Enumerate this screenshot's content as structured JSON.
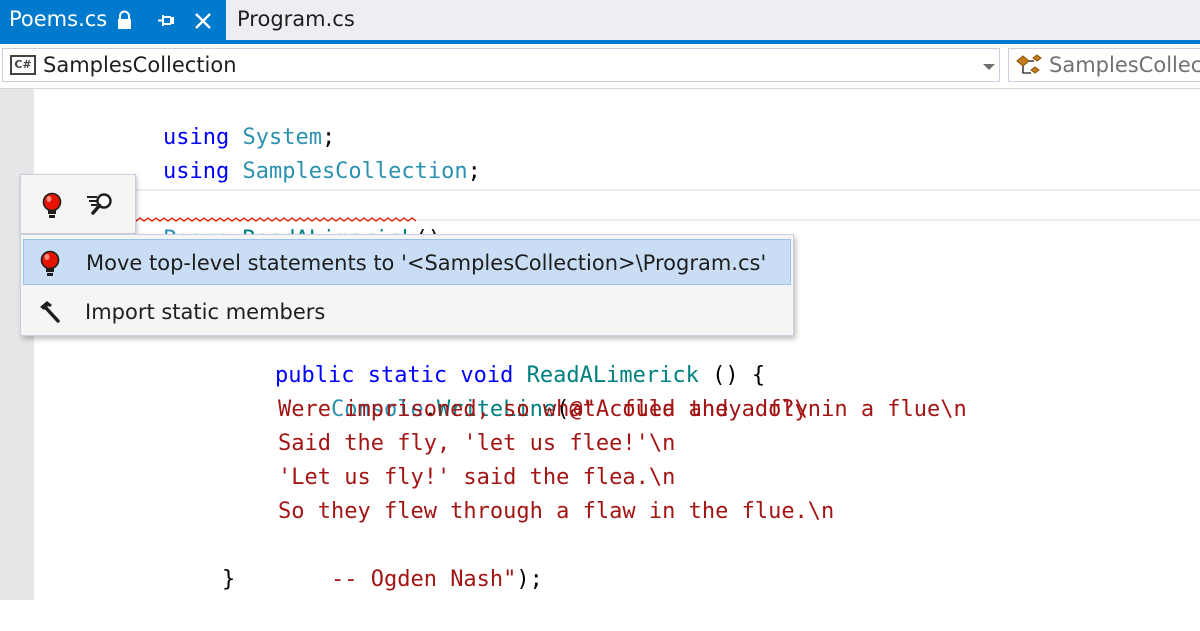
{
  "tabs": [
    {
      "label": "Poems.cs",
      "active": true
    },
    {
      "label": "Program.cs",
      "active": false
    }
  ],
  "navbar": {
    "project_icon": "csharp-file-icon",
    "project_label": "SamplesCollection",
    "member_icon": "class-icon",
    "member_label": "SamplesCollection"
  },
  "editor": {
    "line_using_1": {
      "kw": "using",
      "name": "System",
      "end": ";"
    },
    "line_using_2": {
      "kw": "using",
      "name": "SamplesCollection",
      "end": ";"
    },
    "line_call": {
      "obj": "Poems",
      "dot": ".",
      "method": "ReadALimerick",
      "end": "();"
    },
    "line_method": {
      "mods": "public static void",
      "method": "ReadALimerick",
      "end": "() {"
    },
    "line_writeline": {
      "obj": "Console",
      "dot": ".",
      "method": "WriteLine",
      "open": "(",
      "str": "@\"A flea and a fly in a flue\\n"
    },
    "poem_lines": [
      "Were imprisoned, so what could they do?\\n",
      "Said the fly, 'let us flee!'\\n",
      "'Let us fly!' said the flea.\\n",
      "So they flew through a flaw in the flue.\\n",
      "-- Ogden Nash\""
    ],
    "poem_end": ");",
    "closing_brace": "}"
  },
  "quick_actions": {
    "bulb_icon": "lightbulb-error-icon",
    "preview_icon": "preview-changes-icon",
    "items": [
      {
        "icon": "lightbulb-error-icon",
        "label": "Move top-level statements to '<SamplesCollection>\\Program.cs'",
        "selected": true
      },
      {
        "icon": "hammer-icon",
        "label": "Import static members",
        "selected": false
      }
    ]
  },
  "colors": {
    "accent": "#007acc",
    "keyword": "#0000ff",
    "type": "#2b91af",
    "method": "#008080",
    "string": "#a31515",
    "error_squiggle": "#e51400",
    "selection": "#c9def5"
  }
}
